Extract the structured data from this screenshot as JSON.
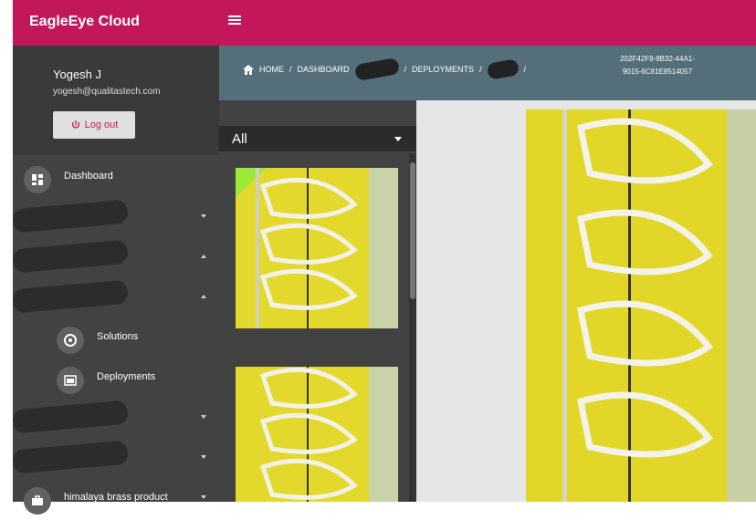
{
  "app": {
    "title": "EagleEye Cloud"
  },
  "user": {
    "name": "Yogesh J",
    "email": "yogesh@qualitastech.com",
    "logout_label": "Log out"
  },
  "sidebar": {
    "items": [
      {
        "label": "Dashboard",
        "icon": "dashboard-icon"
      },
      {
        "label": "",
        "icon": "redacted-icon"
      },
      {
        "label": "",
        "icon": "redacted-icon"
      },
      {
        "label": "",
        "icon": "redacted-icon"
      },
      {
        "label": "Solutions",
        "icon": "solutions-icon"
      },
      {
        "label": "Deployments",
        "icon": "deployments-icon"
      },
      {
        "label": "",
        "icon": "redacted-icon"
      },
      {
        "label": "",
        "icon": "redacted-icon"
      },
      {
        "label": "himalaya brass product",
        "icon": "briefcase-icon"
      }
    ]
  },
  "breadcrumb": {
    "home": "HOME",
    "dashboard": "DASHBOARD",
    "deployments": "DEPLOYMENTS",
    "separator": "/",
    "id_line1": "202F42F9-8B32-44A1-",
    "id_line2": "9015-6C81E8514057"
  },
  "filter": {
    "selected": "All"
  },
  "colors": {
    "brand": "#c2185b",
    "sidebar": "#424242",
    "breadcrumb": "#546e7a",
    "panel_yellow": "#e6dc30"
  }
}
